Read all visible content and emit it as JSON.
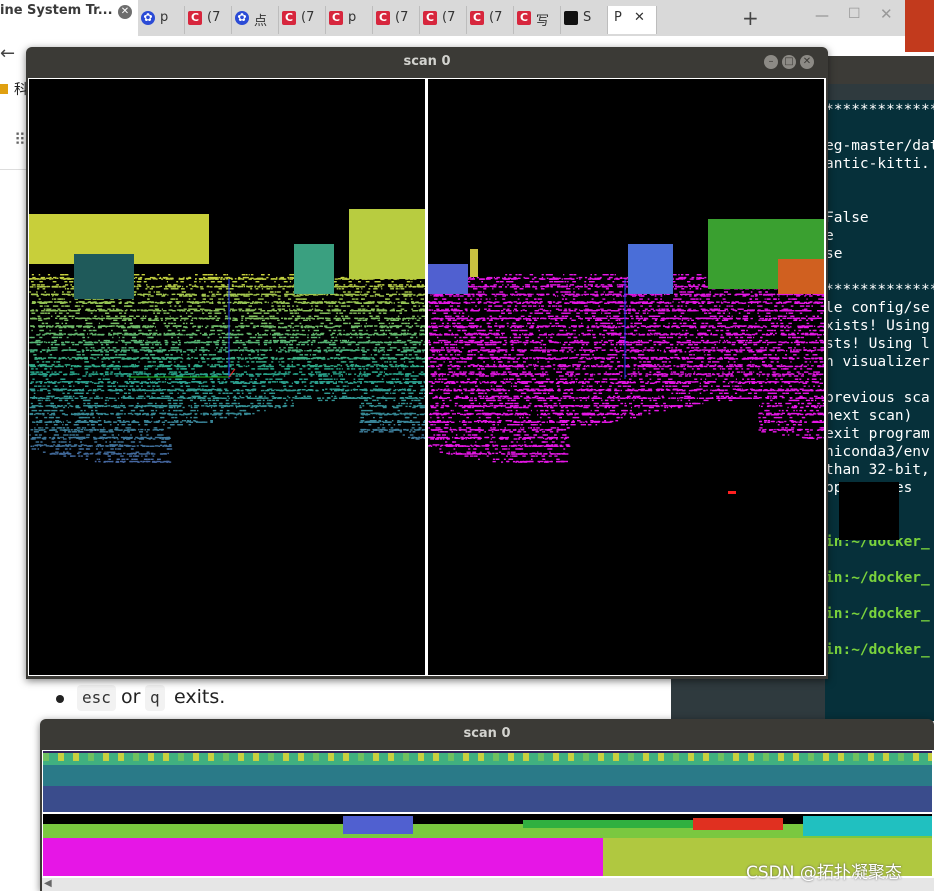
{
  "browser": {
    "first_tab_title": "ine System Tr...",
    "tabs": [
      {
        "icon": "paw-icon",
        "label": "p"
      },
      {
        "icon": "csdn-icon",
        "label": "(7"
      },
      {
        "icon": "paw-icon",
        "label": "点"
      },
      {
        "icon": "csdn-icon",
        "label": "(7"
      },
      {
        "icon": "csdn-icon",
        "label": "p"
      },
      {
        "icon": "csdn-icon",
        "label": "(7"
      },
      {
        "icon": "csdn-icon",
        "label": "(7"
      },
      {
        "icon": "csdn-icon",
        "label": "(7"
      },
      {
        "icon": "csdn-icon",
        "label": "写"
      },
      {
        "icon": "semantic-kitti-icon",
        "label": "S"
      },
      {
        "icon": "",
        "label": "P"
      }
    ],
    "bookmark_label": "科",
    "colors": {
      "accent": "#d7263d"
    }
  },
  "page": {
    "bullet": {
      "key1": "esc",
      "or": "or",
      "key2": "q",
      "suffix": "exits."
    }
  },
  "terminal": {
    "lines": [
      {
        "text": "**************",
        "type": "out"
      },
      {
        "text": "",
        "type": "out"
      },
      {
        "text": "eg-master/dat",
        "type": "out"
      },
      {
        "text": "antic-kitti.",
        "type": "out"
      },
      {
        "text": "",
        "type": "out"
      },
      {
        "text": "",
        "type": "out"
      },
      {
        "text": "False",
        "type": "out"
      },
      {
        "text": "e",
        "type": "out"
      },
      {
        "text": "se",
        "type": "out"
      },
      {
        "text": "",
        "type": "out"
      },
      {
        "text": "**************",
        "type": "out"
      },
      {
        "text": "le config/se",
        "type": "out"
      },
      {
        "text": "xists! Using",
        "type": "out"
      },
      {
        "text": "sts! Using l",
        "type": "out"
      },
      {
        "text": "n visualizer",
        "type": "out"
      },
      {
        "text": "",
        "type": "out"
      },
      {
        "text": "previous sca",
        "type": "out"
      },
      {
        "text": "next scan)",
        "type": "out"
      },
      {
        "text": "exit program",
        "type": "out"
      },
      {
        "text": "niconda3/env",
        "type": "out"
      },
      {
        "text": "than 32-bit,",
        "type": "out"
      },
      {
        "text": "ppp  types",
        "type": "out"
      },
      {
        "text": "",
        "type": "out"
      },
      {
        "text": "",
        "type": "out"
      },
      {
        "text": "in:~/docker_",
        "type": "prompt"
      },
      {
        "text": "",
        "type": "out"
      },
      {
        "text": "in:~/docker_",
        "type": "prompt"
      },
      {
        "text": "",
        "type": "out"
      },
      {
        "text": "in:~/docker_",
        "type": "prompt"
      },
      {
        "text": "",
        "type": "out"
      },
      {
        "text": "in:~/docker_",
        "type": "prompt"
      }
    ]
  },
  "scan_window_1": {
    "title": "scan 0"
  },
  "scan_window_2": {
    "title": "scan 0"
  },
  "watermark": "CSDN @拓扑凝聚态"
}
